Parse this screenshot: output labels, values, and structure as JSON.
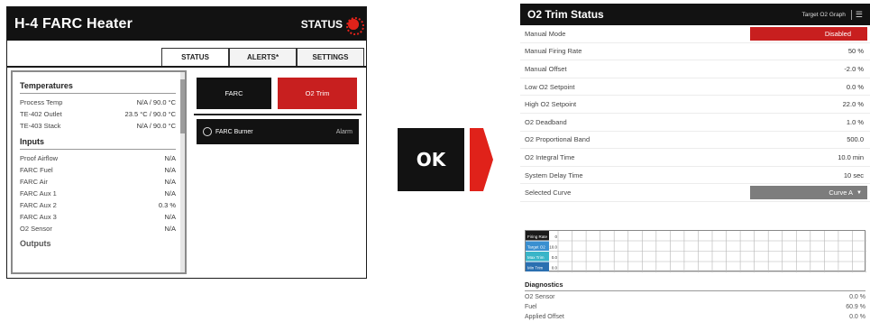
{
  "left_panel": {
    "title": "H-4 FARC Heater",
    "status_label": "STATUS",
    "tabs": [
      {
        "label": "STATUS"
      },
      {
        "label": "ALERTS*"
      },
      {
        "label": "SETTINGS"
      }
    ],
    "temperatures": {
      "title": "Temperatures",
      "rows": [
        {
          "label": "Process Temp",
          "value": "N/A / 90.0 °C"
        },
        {
          "label": "TE-402 Outlet",
          "value": "23.5 °C / 90.0 °C"
        },
        {
          "label": "TE-403 Stack",
          "value": "N/A / 90.0 °C"
        }
      ]
    },
    "inputs": {
      "title": "Inputs",
      "rows": [
        {
          "label": "Proof Airflow",
          "value": "N/A"
        },
        {
          "label": "FARC Fuel",
          "value": "N/A"
        },
        {
          "label": "FARC Air",
          "value": "N/A"
        },
        {
          "label": "FARC Aux 1",
          "value": "N/A"
        },
        {
          "label": "FARC Aux 2",
          "value": "0.3 %"
        },
        {
          "label": "FARC Aux 3",
          "value": "N/A"
        },
        {
          "label": "O2 Sensor",
          "value": "N/A"
        }
      ]
    },
    "next_section_partial": "Outputs",
    "buttons": {
      "farc": "FARC",
      "o2_trim": "O2 Trim"
    },
    "burner": {
      "label": "FARC Burner",
      "state": "Alarm"
    }
  },
  "transition": {
    "ok_label": "OK",
    "arrow_color": "#e0221a"
  },
  "right_panel": {
    "title": "O2 Trim Status",
    "subtitle": "Target O2 Graph",
    "settings_glyph": "☰",
    "rows": [
      {
        "label": "Manual Mode",
        "value": "Disabled",
        "style": "red"
      },
      {
        "label": "Manual Firing Rate",
        "value": "50 %"
      },
      {
        "label": "Manual Offset",
        "value": "-2.0 %"
      },
      {
        "label": "Low O2 Setpoint",
        "value": "0.0 %"
      },
      {
        "label": "High O2 Setpoint",
        "value": "22.0 %"
      },
      {
        "label": "O2 Deadband",
        "value": "1.0 %"
      },
      {
        "label": "O2 Proportional Band",
        "value": "500.0"
      },
      {
        "label": "O2 Integral Time",
        "value": "10.0 min"
      },
      {
        "label": "System Delay Time",
        "value": "10 sec"
      },
      {
        "label": "Selected Curve",
        "value": "Curve A",
        "style": "gray"
      }
    ],
    "curve_table": {
      "row_labels": [
        "Firing Rate",
        "Target O2",
        "Max Trim",
        "Min Trim"
      ],
      "first_col_values": [
        "0",
        "10.0",
        "0.0",
        "0.0"
      ],
      "row_label_colors": [
        "#1a1a1a",
        "#3a8fd0",
        "#39b5c8",
        "#2a6fb0"
      ]
    },
    "diagnostics": {
      "title": "Diagnostics",
      "rows": [
        {
          "label": "O2 Sensor",
          "value": "0.0 %"
        },
        {
          "label": "Fuel",
          "value": "60.9 %"
        },
        {
          "label": "Applied Offset",
          "value": "0.0 %"
        }
      ]
    }
  },
  "colors": {
    "dark": "#121212",
    "accent_red": "#c81f1f",
    "gray_badge": "#7d7d7d"
  }
}
